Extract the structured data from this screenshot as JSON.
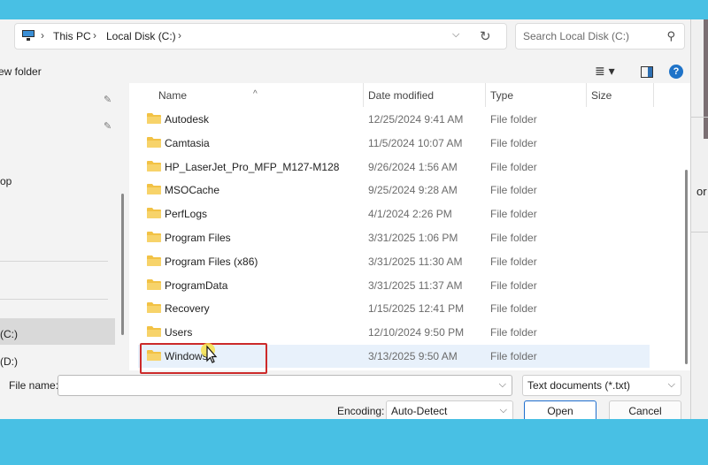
{
  "address": {
    "crumbs": [
      "This PC",
      "Local Disk (C:)"
    ]
  },
  "search": {
    "placeholder": "Search Local Disk (C:)"
  },
  "toolbar": {
    "new_folder": "ew folder"
  },
  "nav": {
    "items": [
      "op",
      "(C:)",
      "(D:)"
    ]
  },
  "columns": {
    "name": "Name",
    "date": "Date modified",
    "type": "Type",
    "size": "Size"
  },
  "rows": [
    {
      "name": "Autodesk",
      "date": "12/25/2024 9:41 AM",
      "type": "File folder"
    },
    {
      "name": "Camtasia",
      "date": "11/5/2024 10:07 AM",
      "type": "File folder"
    },
    {
      "name": "HP_LaserJet_Pro_MFP_M127-M128",
      "date": "9/26/2024 1:56 AM",
      "type": "File folder"
    },
    {
      "name": "MSOCache",
      "date": "9/25/2024 9:28 AM",
      "type": "File folder"
    },
    {
      "name": "PerfLogs",
      "date": "4/1/2024 2:26 PM",
      "type": "File folder"
    },
    {
      "name": "Program Files",
      "date": "3/31/2025 1:06 PM",
      "type": "File folder"
    },
    {
      "name": "Program Files (x86)",
      "date": "3/31/2025 11:30 AM",
      "type": "File folder"
    },
    {
      "name": "ProgramData",
      "date": "3/31/2025 11:37 AM",
      "type": "File folder"
    },
    {
      "name": "Recovery",
      "date": "1/15/2025 12:41 PM",
      "type": "File folder"
    },
    {
      "name": "Users",
      "date": "12/10/2024 9:50 PM",
      "type": "File folder"
    },
    {
      "name": "Windows",
      "date": "3/13/2025 9:50 AM",
      "type": "File folder"
    }
  ],
  "bottom": {
    "file_name_label": "File name:",
    "file_name_value": "",
    "file_type": "Text documents (*.txt)",
    "encoding_label": "Encoding:",
    "encoding_value": "Auto-Detect",
    "open": "Open",
    "cancel": "Cancel"
  },
  "background_window": {
    "text": "or"
  },
  "colors": {
    "accent": "#1f6fcf",
    "highlight": "#cc2a2a",
    "folder": "#f2c245",
    "backdrop": "#48c0e4"
  }
}
